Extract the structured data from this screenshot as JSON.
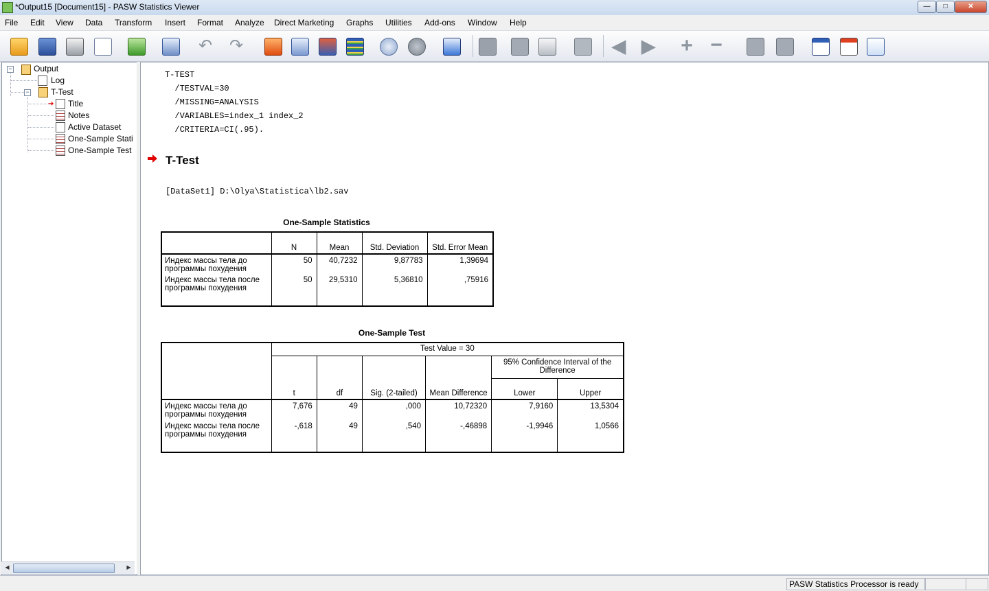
{
  "window": {
    "title": "*Output15 [Document15] - PASW Statistics Viewer",
    "min_label": "—",
    "max_label": "□",
    "close_label": "✕"
  },
  "menu": [
    "File",
    "Edit",
    "View",
    "Data",
    "Transform",
    "Insert",
    "Format",
    "Analyze",
    "Direct Marketing",
    "Graphs",
    "Utilities",
    "Add-ons",
    "Window",
    "Help"
  ],
  "toolbar_icons": [
    "open-icon",
    "save-icon",
    "print-icon",
    "print-preview-icon",
    "export-icon",
    "recall-dialog-icon",
    "undo-icon",
    "redo-icon",
    "goto-data-icon",
    "goto-case-icon",
    "goto-variable-icon",
    "variables-icon",
    "use-sets-icon",
    "show-all-icon",
    "select-cases-icon",
    "designate-window-icon",
    "insert-heading-icon",
    "insert-title-icon",
    "insert-text-icon",
    "insert-script-icon",
    "new-page-icon",
    "back-icon",
    "forward-icon",
    "expand-icon",
    "collapse-icon",
    "show-icon",
    "hide-icon",
    "pivot-icon",
    "export-outline-icon",
    "export-table-icon"
  ],
  "outline": {
    "items": [
      "Output",
      "Log",
      "T-Test",
      "Title",
      "Notes",
      "Active Dataset",
      "One-Sample Stati",
      "One-Sample Test"
    ]
  },
  "syntax_lines": [
    "T-TEST",
    "  /TESTVAL=30",
    "  /MISSING=ANALYSIS",
    "  /VARIABLES=index_1 index_2",
    "  /CRITERIA=CI(.95)."
  ],
  "section_title": "T-Test",
  "dataset_line": "[DataSet1] D:\\Olya\\Statistica\\lb2.sav",
  "stats_table": {
    "title": "One-Sample Statistics",
    "headers": [
      "",
      "N",
      "Mean",
      "Std. Deviation",
      "Std. Error Mean"
    ],
    "rows": [
      {
        "label": "Индекс массы тела до программы похудения",
        "n": "50",
        "mean": "40,7232",
        "sd": "9,87783",
        "se": "1,39694"
      },
      {
        "label": "Индекс массы тела после программы похудения",
        "n": "50",
        "mean": "29,5310",
        "sd": "5,36810",
        "se": ",75916"
      }
    ]
  },
  "test_table": {
    "title": "One-Sample Test",
    "test_value": "Test Value = 30",
    "ci_header": "95% Confidence Interval of the Difference",
    "headers": [
      "t",
      "df",
      "Sig. (2-tailed)",
      "Mean Difference",
      "Lower",
      "Upper"
    ],
    "rows": [
      {
        "label": "Индекс массы тела до программы похудения",
        "t": "7,676",
        "df": "49",
        "sig": ",000",
        "md": "10,72320",
        "lower": "7,9160",
        "upper": "13,5304"
      },
      {
        "label": "Индекс массы тела после программы похудения",
        "t": "-,618",
        "df": "49",
        "sig": ",540",
        "md": "-,46898",
        "lower": "-1,9946",
        "upper": "1,0566"
      }
    ]
  },
  "status": {
    "processor": "PASW Statistics Processor is ready"
  }
}
